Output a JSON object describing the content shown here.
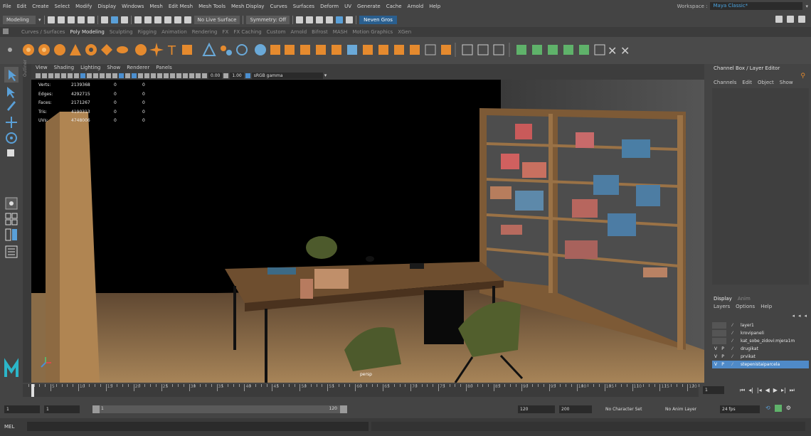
{
  "menubar": {
    "items": [
      "File",
      "Edit",
      "Create",
      "Select",
      "Modify",
      "Display",
      "Windows",
      "Mesh",
      "Edit Mesh",
      "Mesh Tools",
      "Mesh Display",
      "Curves",
      "Surfaces",
      "Deform",
      "UV",
      "Generate",
      "Cache",
      "Arnold",
      "Help"
    ],
    "workspace_label": "Workspace :",
    "workspace_value": "Maya Classic*"
  },
  "statusline": {
    "mode": "Modeling",
    "live_surface": "No Live Surface",
    "symmetry": "Symmetry: Off",
    "user": "Neven Gros"
  },
  "shelf": {
    "tabs": [
      "Curves / Surfaces",
      "Poly Modeling",
      "Sculpting",
      "Rigging",
      "Animation",
      "Rendering",
      "FX",
      "FX Caching",
      "Custom",
      "Arnold",
      "Bifrost",
      "MASH",
      "Motion Graphics",
      "XGen"
    ],
    "active_tab": "Poly Modeling"
  },
  "outliner_strip": {
    "label": "Outliner"
  },
  "viewport": {
    "menu": [
      "View",
      "Shading",
      "Lighting",
      "Show",
      "Renderer",
      "Panels"
    ],
    "exposure": "0.00",
    "gamma_value": "1.00",
    "color_space": "sRGB gamma",
    "camera": "persp",
    "hud": [
      {
        "label": "Verts:",
        "v1": "2139368",
        "v2": "0",
        "v3": "0"
      },
      {
        "label": "Edges:",
        "v1": "4292715",
        "v2": "0",
        "v3": "0"
      },
      {
        "label": "Faces:",
        "v1": "2171267",
        "v2": "0",
        "v3": "0"
      },
      {
        "label": "Tris:",
        "v1": "4190313",
        "v2": "0",
        "v3": "0"
      },
      {
        "label": "UVs:",
        "v1": "4748006",
        "v2": "0",
        "v3": "0"
      }
    ]
  },
  "channelbox": {
    "title": "Channel Box / Layer Editor",
    "menu": [
      "Channels",
      "Edit",
      "Object",
      "Show"
    ]
  },
  "layer_editor": {
    "tabs": [
      "Display",
      "Anim"
    ],
    "menu": [
      "Layers",
      "Options",
      "Help"
    ],
    "layers": [
      {
        "v": "",
        "p": "",
        "name": "layer1"
      },
      {
        "v": "",
        "p": "",
        "name": "krovipaneli"
      },
      {
        "v": "",
        "p": "",
        "name": "kat_sobe_zidovi:mjera1m"
      },
      {
        "v": "V",
        "p": "P",
        "name": "drugikat"
      },
      {
        "v": "V",
        "p": "P",
        "name": "prvikat"
      },
      {
        "v": "V",
        "p": "P",
        "name": "stepenistaiparcela"
      }
    ],
    "selected_layer": "stepenistaiparcela"
  },
  "timeslider": {
    "labels": [
      "5",
      "10",
      "15",
      "20",
      "25",
      "30",
      "35",
      "40",
      "45",
      "50",
      "55",
      "60",
      "65",
      "70",
      "75",
      "80",
      "85",
      "90",
      "95",
      "100",
      "105",
      "110",
      "115",
      "120"
    ],
    "current_frame": "1"
  },
  "rangeslider": {
    "start": "1",
    "inner_start": "1",
    "range_start_marker": "1",
    "range_end_marker": "120",
    "inner_end": "120",
    "end": "200",
    "character_set": "No Character Set",
    "anim_layer": "No Anim Layer",
    "fps": "24 fps"
  },
  "commandline": {
    "label": "MEL"
  }
}
